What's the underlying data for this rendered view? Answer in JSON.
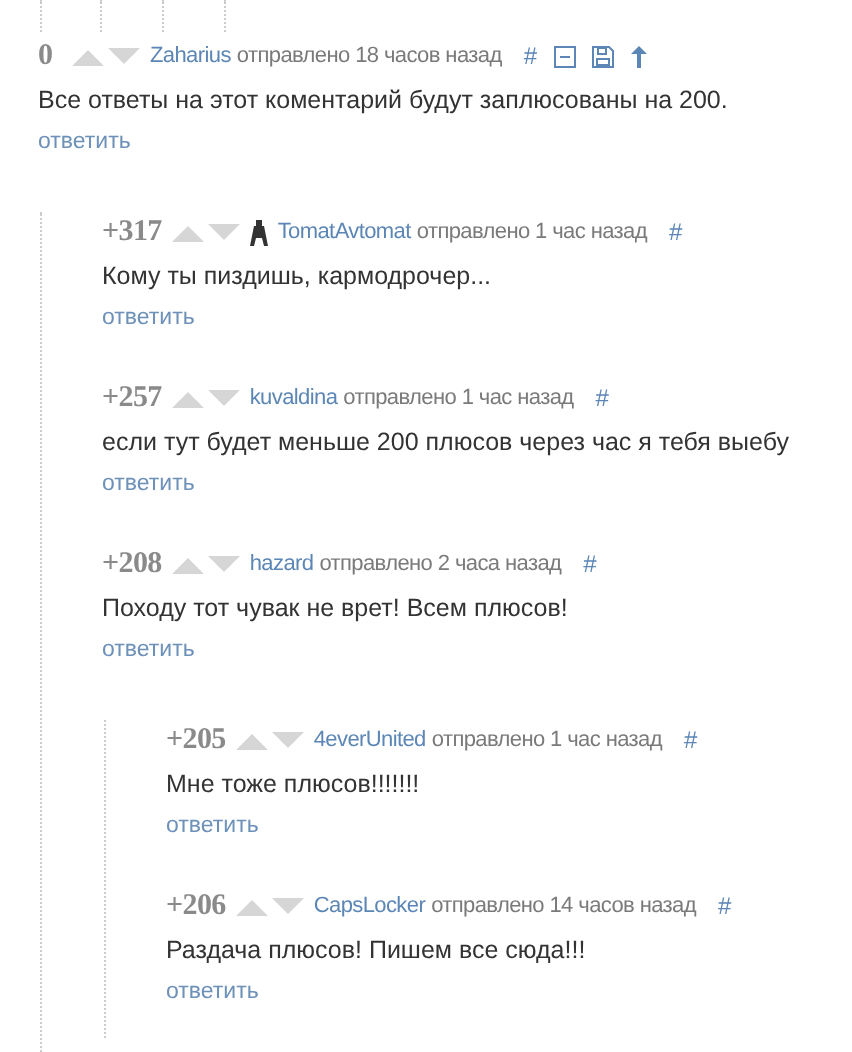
{
  "comments": [
    {
      "rating": "0",
      "author": "Zaharius",
      "meta": "отправлено 18 часов назад",
      "anchor": "#",
      "text": "Все ответы на этот коментарий будут заплюсованы на 200.",
      "reply": "ответить",
      "children": [
        {
          "rating": "+317",
          "author_badge": true,
          "author": "TomatAvtomat",
          "meta": "отправлено 1 час назад",
          "anchor": "#",
          "text": "Кому ты пиздишь, кармодрочер...",
          "reply": "ответить"
        },
        {
          "rating": "+257",
          "author": "kuvaldina",
          "meta": "отправлено 1 час назад",
          "anchor": "#",
          "text": "если тут будет меньше 200 плюсов через час я тебя выебу",
          "reply": "ответить"
        },
        {
          "rating": "+208",
          "author": "hazard",
          "meta": "отправлено 2 часа назад",
          "anchor": "#",
          "text": "Походу тот чувак не врет! Всем плюсов!",
          "reply": "ответить",
          "children": [
            {
              "rating": "+205",
              "author": "4everUnited",
              "meta": "отправлено 1 час назад",
              "anchor": "#",
              "text": "Мне тоже плюсов!!!!!!!",
              "reply": "ответить"
            },
            {
              "rating": "+206",
              "author": "CapsLocker",
              "meta": "отправлено 14 часов назад",
              "anchor": "#",
              "text": "Раздача плюсов! Пишем все сюда!!!",
              "reply": "ответить"
            }
          ]
        }
      ]
    }
  ]
}
